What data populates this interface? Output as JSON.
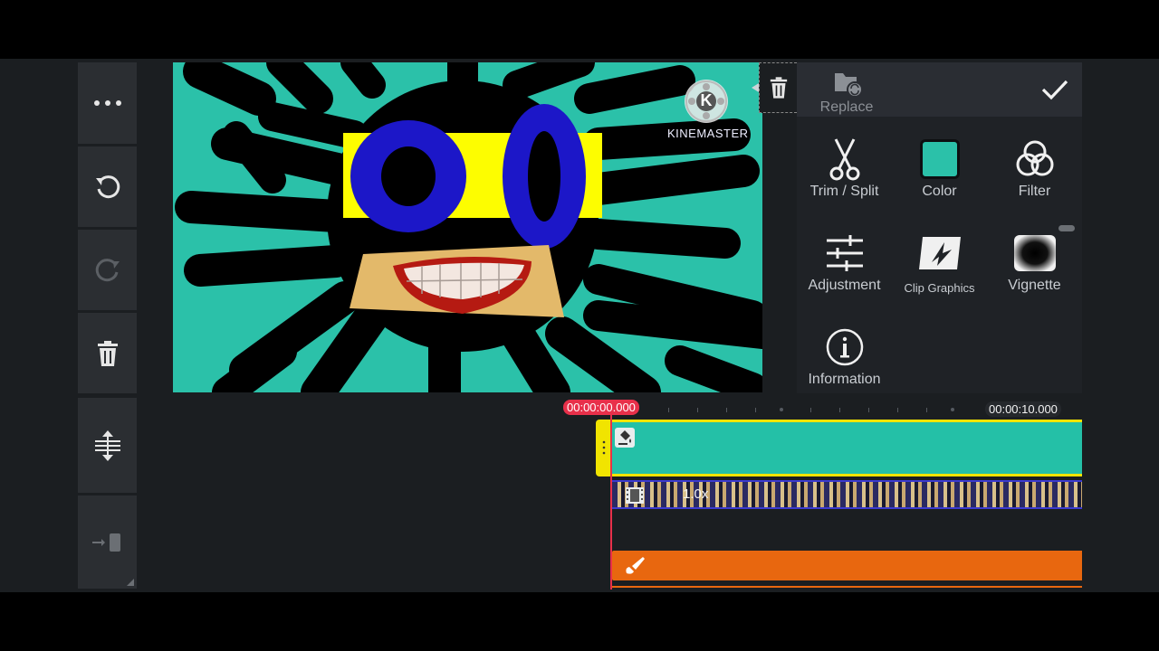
{
  "watermark": {
    "text": "KINEMASTER",
    "letter": "K"
  },
  "panel": {
    "replace_label": "Replace",
    "tools": [
      {
        "label": "Trim / Split",
        "icon": "scissors-icon"
      },
      {
        "label": "Color",
        "icon": "color-swatch-icon"
      },
      {
        "label": "Filter",
        "icon": "filter-icon"
      },
      {
        "label": "Adjustment",
        "icon": "sliders-icon"
      },
      {
        "label": "Clip Graphics",
        "icon": "clip-graphics-icon"
      },
      {
        "label": "Vignette",
        "icon": "vignette-icon"
      },
      {
        "label": "Information",
        "icon": "info-icon"
      }
    ],
    "color_swatch": "#2bc1a9"
  },
  "timeline": {
    "playhead_time": "00:00:00.000",
    "end_time": "00:00:10.000",
    "video_speed": "1.0x"
  },
  "colors": {
    "accent_red": "#e8304a",
    "clip_teal": "#24c0a7",
    "clip_border": "#f1e400",
    "handwriting_layer": "#e8670f"
  }
}
